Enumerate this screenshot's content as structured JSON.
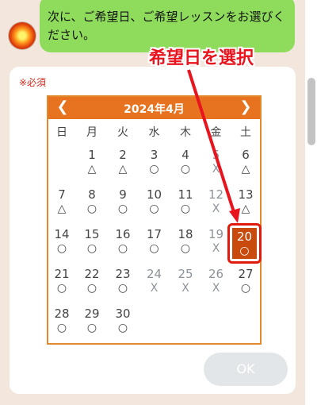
{
  "chat": {
    "message": "次に、ご希望日、ご希望レッスンをお選びください。"
  },
  "form": {
    "required_label": "※必須",
    "ok_label": "OK"
  },
  "annotation": {
    "text": "希望日を選択",
    "color": "#e8141e"
  },
  "calendar": {
    "title": "2024年4月",
    "prev_icon": "chevron-left-icon",
    "next_icon": "chevron-right-icon",
    "weekdays": [
      "日",
      "月",
      "火",
      "水",
      "木",
      "金",
      "土"
    ],
    "selected_day": "20",
    "weeks": [
      [
        null,
        {
          "day": "1",
          "mark": "△"
        },
        {
          "day": "2",
          "mark": "△"
        },
        {
          "day": "3",
          "mark": "○"
        },
        {
          "day": "4",
          "mark": "○"
        },
        {
          "day": "5",
          "mark": "X",
          "unavailable": true
        },
        {
          "day": "6",
          "mark": "△"
        }
      ],
      [
        {
          "day": "7",
          "mark": "△"
        },
        {
          "day": "8",
          "mark": "○"
        },
        {
          "day": "9",
          "mark": "○"
        },
        {
          "day": "10",
          "mark": "○"
        },
        {
          "day": "11",
          "mark": "○"
        },
        {
          "day": "12",
          "mark": "X",
          "unavailable": true
        },
        {
          "day": "13",
          "mark": "△"
        }
      ],
      [
        {
          "day": "14",
          "mark": "○"
        },
        {
          "day": "15",
          "mark": "○"
        },
        {
          "day": "16",
          "mark": "○"
        },
        {
          "day": "17",
          "mark": "○"
        },
        {
          "day": "18",
          "mark": "○"
        },
        {
          "day": "19",
          "mark": "X",
          "unavailable": true
        },
        {
          "day": "20",
          "mark": "○"
        }
      ],
      [
        {
          "day": "21",
          "mark": "○"
        },
        {
          "day": "22",
          "mark": "○"
        },
        {
          "day": "23",
          "mark": "○"
        },
        {
          "day": "24",
          "mark": "X",
          "unavailable": true
        },
        {
          "day": "25",
          "mark": "X",
          "unavailable": true
        },
        {
          "day": "26",
          "mark": "X",
          "unavailable": true
        },
        {
          "day": "27",
          "mark": "○"
        }
      ],
      [
        {
          "day": "28",
          "mark": "○"
        },
        {
          "day": "29",
          "mark": "○"
        },
        {
          "day": "30",
          "mark": "○"
        },
        null,
        null,
        null,
        null
      ]
    ]
  },
  "colors": {
    "header": "#e77320",
    "saturday": "#c6ecf8",
    "sunday": "#f4c0bc",
    "unavailable": "#cdd1d6",
    "selected": "#c84a0d",
    "chat_bubble": "#8fdc5c"
  }
}
